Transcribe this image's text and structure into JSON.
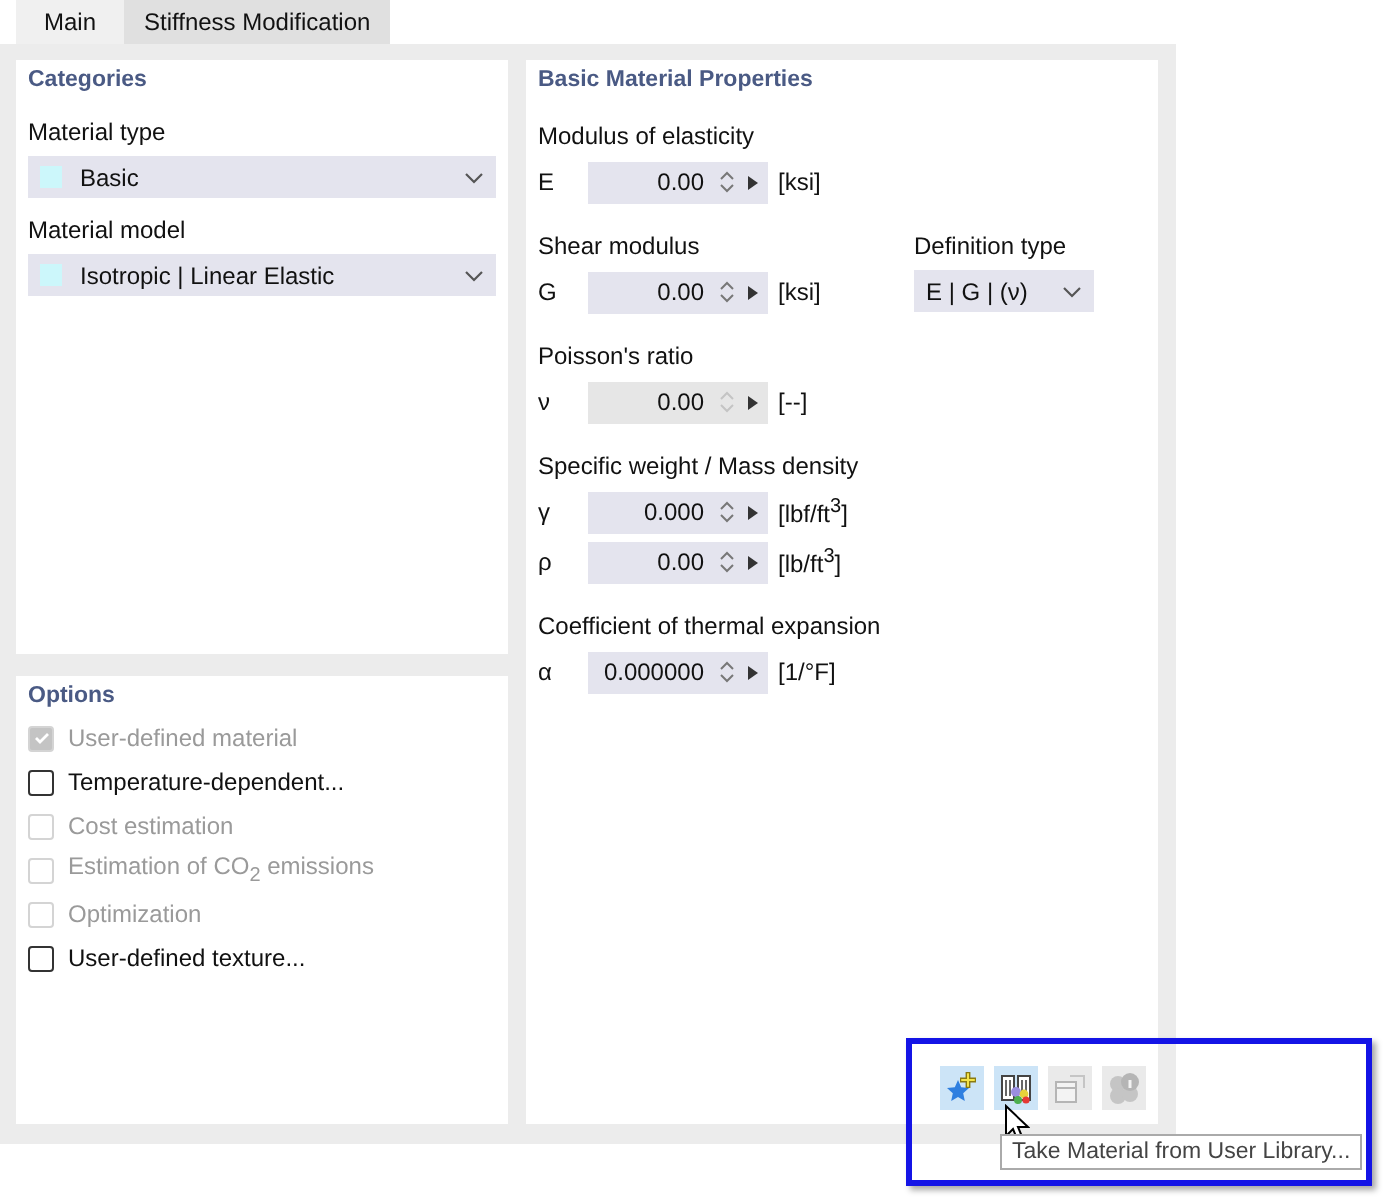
{
  "tabs": [
    {
      "label": "Main",
      "selected": true
    },
    {
      "label": "Stiffness Modification",
      "selected": false
    }
  ],
  "categories": {
    "title": "Categories",
    "fields": [
      {
        "label": "Material type",
        "value": "Basic",
        "color": "#ccf7fb"
      },
      {
        "label": "Material model",
        "value": "Isotropic | Linear Elastic",
        "color": "#ccf7fb"
      }
    ]
  },
  "options": {
    "title": "Options",
    "items": [
      {
        "label": "User-defined material",
        "checked": true,
        "disabled": true
      },
      {
        "label": "Temperature-dependent...",
        "checked": false,
        "disabled": false
      },
      {
        "label": "Cost estimation",
        "checked": false,
        "disabled": true
      },
      {
        "label": "Estimation of CO$_{2}$ emissions",
        "checked": false,
        "disabled": true
      },
      {
        "label": "Optimization",
        "checked": false,
        "disabled": true
      },
      {
        "label": "User-defined texture...",
        "checked": false,
        "disabled": false
      }
    ]
  },
  "properties": {
    "title": "Basic Material Properties",
    "groups": [
      {
        "label": "Modulus of elasticity",
        "rows": [
          {
            "symbol": "E",
            "value": "0.00",
            "unit": "[ksi]",
            "disabled": false
          }
        ]
      },
      {
        "label": "Shear modulus",
        "rows": [
          {
            "symbol": "G",
            "value": "0.00",
            "unit": "[ksi]",
            "disabled": false
          }
        ],
        "side": {
          "label": "Definition type",
          "value": "E | G | (ν)"
        }
      },
      {
        "label": "Poisson's ratio",
        "rows": [
          {
            "symbol": "ν",
            "value": "0.00",
            "unit": "[--]",
            "disabled": true
          }
        ]
      },
      {
        "label": "Specific weight / Mass density",
        "rows": [
          {
            "symbol": "γ",
            "value": "0.000",
            "unit": "[lbf/ft$^{3}$]",
            "disabled": false
          },
          {
            "symbol": "ρ",
            "value": "0.00",
            "unit": "[lb/ft$^{3}$]",
            "disabled": false
          }
        ]
      },
      {
        "label": "Coefficient of thermal expansion",
        "rows": [
          {
            "symbol": "α",
            "value": "0.000000",
            "unit": "[1/°F]",
            "disabled": false
          }
        ]
      }
    ]
  },
  "toolbar": [
    {
      "kind": "star-plus",
      "selected": true,
      "disabled": false
    },
    {
      "kind": "library",
      "selected": true,
      "disabled": false
    },
    {
      "kind": "window",
      "selected": false,
      "disabled": true
    },
    {
      "kind": "info",
      "selected": false,
      "disabled": true
    }
  ],
  "tooltip": "Take Material from User Library..."
}
